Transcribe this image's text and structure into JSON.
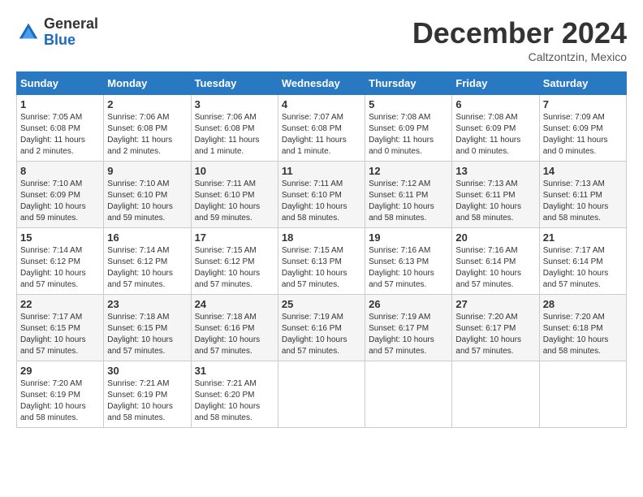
{
  "logo": {
    "general": "General",
    "blue": "Blue"
  },
  "title": "December 2024",
  "location": "Caltzontzin, Mexico",
  "weekdays": [
    "Sunday",
    "Monday",
    "Tuesday",
    "Wednesday",
    "Thursday",
    "Friday",
    "Saturday"
  ],
  "weeks": [
    [
      {
        "day": "1",
        "sunrise": "7:05 AM",
        "sunset": "6:08 PM",
        "daylight": "11 hours and 2 minutes."
      },
      {
        "day": "2",
        "sunrise": "7:06 AM",
        "sunset": "6:08 PM",
        "daylight": "11 hours and 2 minutes."
      },
      {
        "day": "3",
        "sunrise": "7:06 AM",
        "sunset": "6:08 PM",
        "daylight": "11 hours and 1 minute."
      },
      {
        "day": "4",
        "sunrise": "7:07 AM",
        "sunset": "6:08 PM",
        "daylight": "11 hours and 1 minute."
      },
      {
        "day": "5",
        "sunrise": "7:08 AM",
        "sunset": "6:09 PM",
        "daylight": "11 hours and 0 minutes."
      },
      {
        "day": "6",
        "sunrise": "7:08 AM",
        "sunset": "6:09 PM",
        "daylight": "11 hours and 0 minutes."
      },
      {
        "day": "7",
        "sunrise": "7:09 AM",
        "sunset": "6:09 PM",
        "daylight": "11 hours and 0 minutes."
      }
    ],
    [
      {
        "day": "8",
        "sunrise": "7:10 AM",
        "sunset": "6:09 PM",
        "daylight": "10 hours and 59 minutes."
      },
      {
        "day": "9",
        "sunrise": "7:10 AM",
        "sunset": "6:10 PM",
        "daylight": "10 hours and 59 minutes."
      },
      {
        "day": "10",
        "sunrise": "7:11 AM",
        "sunset": "6:10 PM",
        "daylight": "10 hours and 59 minutes."
      },
      {
        "day": "11",
        "sunrise": "7:11 AM",
        "sunset": "6:10 PM",
        "daylight": "10 hours and 58 minutes."
      },
      {
        "day": "12",
        "sunrise": "7:12 AM",
        "sunset": "6:11 PM",
        "daylight": "10 hours and 58 minutes."
      },
      {
        "day": "13",
        "sunrise": "7:13 AM",
        "sunset": "6:11 PM",
        "daylight": "10 hours and 58 minutes."
      },
      {
        "day": "14",
        "sunrise": "7:13 AM",
        "sunset": "6:11 PM",
        "daylight": "10 hours and 58 minutes."
      }
    ],
    [
      {
        "day": "15",
        "sunrise": "7:14 AM",
        "sunset": "6:12 PM",
        "daylight": "10 hours and 57 minutes."
      },
      {
        "day": "16",
        "sunrise": "7:14 AM",
        "sunset": "6:12 PM",
        "daylight": "10 hours and 57 minutes."
      },
      {
        "day": "17",
        "sunrise": "7:15 AM",
        "sunset": "6:12 PM",
        "daylight": "10 hours and 57 minutes."
      },
      {
        "day": "18",
        "sunrise": "7:15 AM",
        "sunset": "6:13 PM",
        "daylight": "10 hours and 57 minutes."
      },
      {
        "day": "19",
        "sunrise": "7:16 AM",
        "sunset": "6:13 PM",
        "daylight": "10 hours and 57 minutes."
      },
      {
        "day": "20",
        "sunrise": "7:16 AM",
        "sunset": "6:14 PM",
        "daylight": "10 hours and 57 minutes."
      },
      {
        "day": "21",
        "sunrise": "7:17 AM",
        "sunset": "6:14 PM",
        "daylight": "10 hours and 57 minutes."
      }
    ],
    [
      {
        "day": "22",
        "sunrise": "7:17 AM",
        "sunset": "6:15 PM",
        "daylight": "10 hours and 57 minutes."
      },
      {
        "day": "23",
        "sunrise": "7:18 AM",
        "sunset": "6:15 PM",
        "daylight": "10 hours and 57 minutes."
      },
      {
        "day": "24",
        "sunrise": "7:18 AM",
        "sunset": "6:16 PM",
        "daylight": "10 hours and 57 minutes."
      },
      {
        "day": "25",
        "sunrise": "7:19 AM",
        "sunset": "6:16 PM",
        "daylight": "10 hours and 57 minutes."
      },
      {
        "day": "26",
        "sunrise": "7:19 AM",
        "sunset": "6:17 PM",
        "daylight": "10 hours and 57 minutes."
      },
      {
        "day": "27",
        "sunrise": "7:20 AM",
        "sunset": "6:17 PM",
        "daylight": "10 hours and 57 minutes."
      },
      {
        "day": "28",
        "sunrise": "7:20 AM",
        "sunset": "6:18 PM",
        "daylight": "10 hours and 58 minutes."
      }
    ],
    [
      {
        "day": "29",
        "sunrise": "7:20 AM",
        "sunset": "6:19 PM",
        "daylight": "10 hours and 58 minutes."
      },
      {
        "day": "30",
        "sunrise": "7:21 AM",
        "sunset": "6:19 PM",
        "daylight": "10 hours and 58 minutes."
      },
      {
        "day": "31",
        "sunrise": "7:21 AM",
        "sunset": "6:20 PM",
        "daylight": "10 hours and 58 minutes."
      },
      null,
      null,
      null,
      null
    ]
  ]
}
